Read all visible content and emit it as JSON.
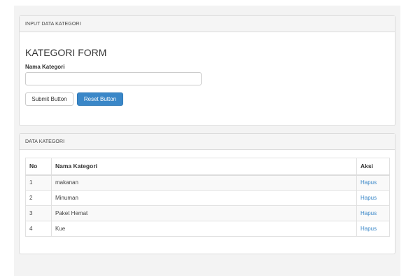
{
  "input_panel": {
    "heading": "INPUT DATA KATEGORI",
    "form_title": "KATEGORI FORM",
    "field_label": "Nama Kategori",
    "field_value": "",
    "submit_label": "Submit Button",
    "reset_label": "Reset Button"
  },
  "data_panel": {
    "heading": "DATA KATEGORI",
    "columns": [
      "No",
      "Nama Kategori",
      "Aksi"
    ],
    "rows": [
      {
        "no": "1",
        "nama": "makanan",
        "aksi": "Hapus"
      },
      {
        "no": "2",
        "nama": "Minuman",
        "aksi": "Hapus"
      },
      {
        "no": "3",
        "nama": "Paket Hemat",
        "aksi": "Hapus"
      },
      {
        "no": "4",
        "nama": "Kue",
        "aksi": "Hapus"
      }
    ]
  },
  "colors": {
    "primary": "#3a87c8",
    "link": "#3a87c8",
    "panel_border": "#dcdcdc",
    "heading_bg": "#f5f5f5"
  }
}
